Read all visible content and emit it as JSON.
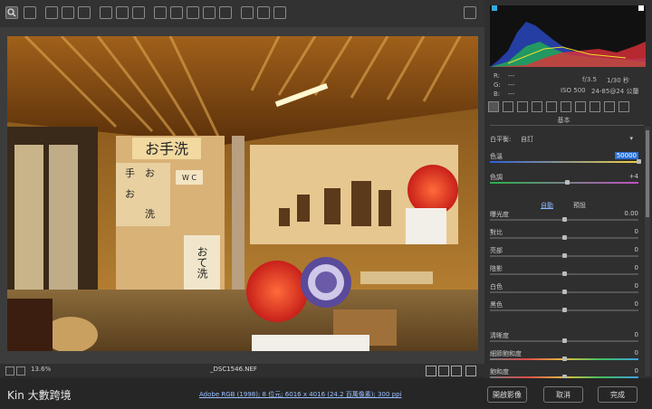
{
  "footer": {
    "filename": "_DSC1546.NEF",
    "zoom": "13.6%",
    "info": "Adobe RGB (1998); 8 位元; 6016 x 4016 (24.2 百萬像素); 300 ppi",
    "open_label": "開啟影像",
    "cancel_label": "取消",
    "done_label": "完成",
    "watermark": "Kin 大數跨境"
  },
  "metadata": {
    "r": "R:",
    "g": "G:",
    "b": "B:",
    "r_val": "---",
    "g_val": "---",
    "b_val": "---",
    "aperture": "f/3.5",
    "shutter": "1/30 秒",
    "iso": "ISO 500",
    "lens": "24-85@24 公釐"
  },
  "panel": {
    "section_title": "基本",
    "white_balance_label": "白平衡:",
    "white_balance_value": "自訂",
    "auto_label": "自動",
    "default_label": "預設",
    "sliders": [
      {
        "label": "色溫",
        "value": "50000",
        "pos": 1.0,
        "track": "temp"
      },
      {
        "label": "色調",
        "value": "+4",
        "pos": 0.52,
        "track": "tint"
      },
      {
        "label": "曝光度",
        "value": "0.00",
        "pos": 0.5,
        "track": "gray"
      },
      {
        "label": "對比",
        "value": "0",
        "pos": 0.5,
        "track": "gray"
      },
      {
        "label": "亮部",
        "value": "0",
        "pos": 0.5,
        "track": "gray"
      },
      {
        "label": "陰影",
        "value": "0",
        "pos": 0.5,
        "track": "gray"
      },
      {
        "label": "白色",
        "value": "0",
        "pos": 0.5,
        "track": "gray"
      },
      {
        "label": "黑色",
        "value": "0",
        "pos": 0.5,
        "track": "gray"
      },
      {
        "label": "清晰度",
        "value": "0",
        "pos": 0.5,
        "track": "gray"
      },
      {
        "label": "細節飽和度",
        "value": "0",
        "pos": 0.5,
        "track": "sat"
      },
      {
        "label": "飽和度",
        "value": "0",
        "pos": 0.5,
        "track": "sat"
      }
    ]
  },
  "photo": {
    "sign_top": "お手洗",
    "sign_bottom": "おて洗",
    "wc": "W C",
    "grid_chars": [
      "手",
      "お",
      "お",
      "洗"
    ]
  },
  "colors": {
    "accent": "#2b6fd6",
    "bg": "#2b2b2b"
  }
}
